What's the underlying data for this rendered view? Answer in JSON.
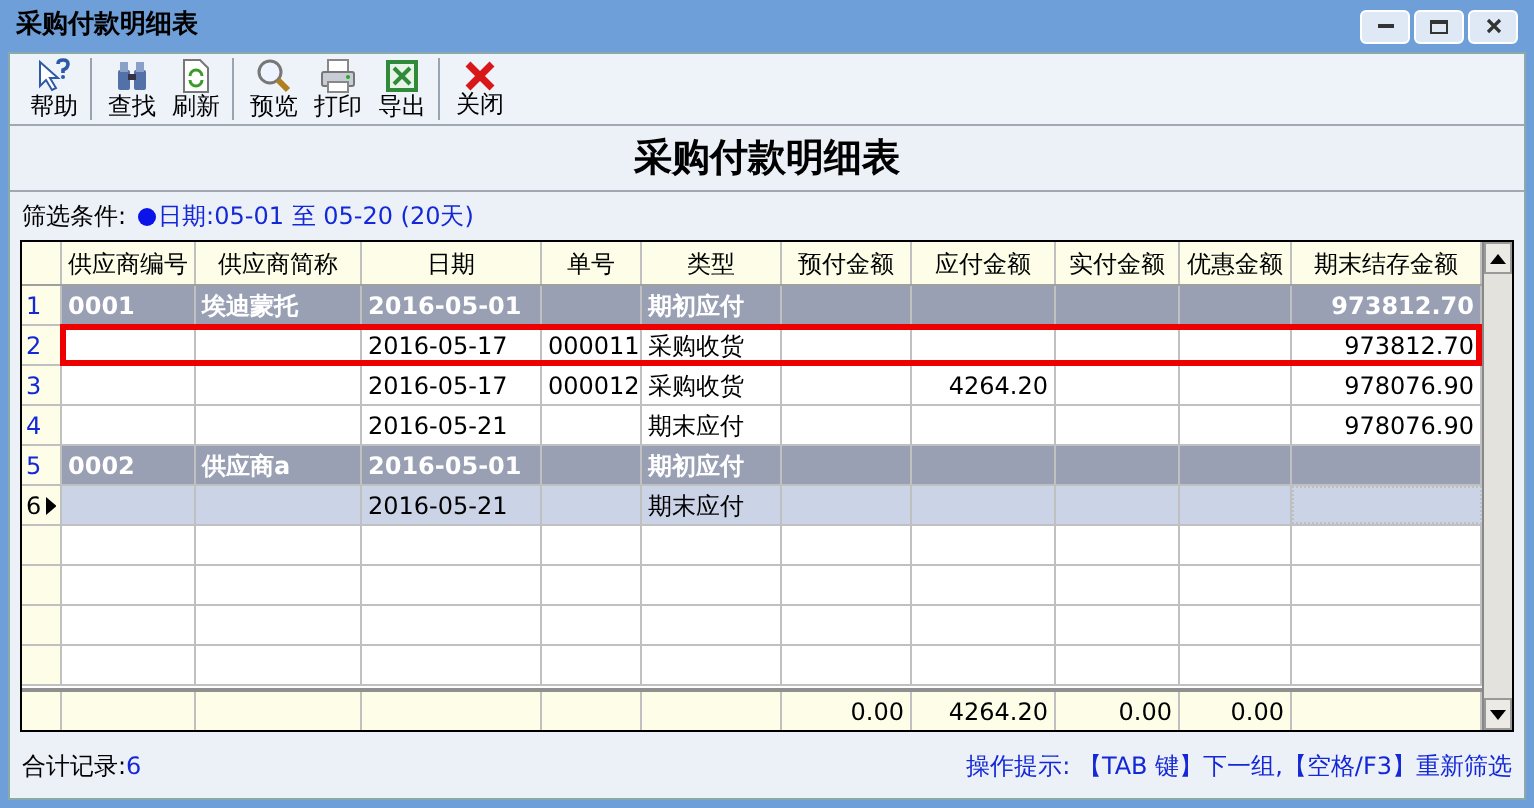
{
  "window": {
    "title": "采购付款明细表"
  },
  "toolbar": [
    {
      "kind": "help",
      "label": "帮助",
      "separator_after": true
    },
    {
      "kind": "find",
      "label": "查找",
      "separator_after": false
    },
    {
      "kind": "refresh",
      "label": "刷新",
      "separator_after": true
    },
    {
      "kind": "preview",
      "label": "预览",
      "separator_after": false
    },
    {
      "kind": "print",
      "label": "打印",
      "separator_after": false
    },
    {
      "kind": "export",
      "label": "导出",
      "separator_after": true
    },
    {
      "kind": "close",
      "label": "关闭",
      "separator_after": false
    }
  ],
  "report_title": "采购付款明细表",
  "filter": {
    "label": "筛选条件:",
    "value": "日期:05-01 至 05-20 (20天)"
  },
  "table": {
    "columns": [
      "供应商编号",
      "供应商简称",
      "日期",
      "单号",
      "类型",
      "预付金额",
      "应付金额",
      "实付金额",
      "优惠金额",
      "期末结存金额"
    ],
    "rows": [
      {
        "number": "1",
        "kind": "group",
        "highlighted": false,
        "current": false,
        "cells": [
          "0001",
          "埃迪蒙托",
          "2016-05-01",
          "",
          "期初应付",
          "",
          "",
          "",
          "",
          "973812.70"
        ]
      },
      {
        "number": "2",
        "kind": "detail",
        "highlighted": true,
        "current": false,
        "cells": [
          "",
          "",
          "2016-05-17",
          "000011",
          "采购收货",
          "",
          "",
          "",
          "",
          "973812.70"
        ]
      },
      {
        "number": "3",
        "kind": "detail",
        "highlighted": false,
        "current": false,
        "cells": [
          "",
          "",
          "2016-05-17",
          "000012",
          "采购收货",
          "",
          "4264.20",
          "",
          "",
          "978076.90"
        ]
      },
      {
        "number": "4",
        "kind": "detail",
        "highlighted": false,
        "current": false,
        "cells": [
          "",
          "",
          "2016-05-21",
          "",
          "期末应付",
          "",
          "",
          "",
          "",
          "978076.90"
        ]
      },
      {
        "number": "5",
        "kind": "group",
        "highlighted": false,
        "current": false,
        "cells": [
          "0002",
          "供应商a",
          "2016-05-01",
          "",
          "期初应付",
          "",
          "",
          "",
          "",
          ""
        ]
      },
      {
        "number": "6",
        "kind": "detail",
        "highlighted": false,
        "current": true,
        "cells": [
          "",
          "",
          "2016-05-21",
          "",
          "期末应付",
          "",
          "",
          "",
          "",
          ""
        ]
      }
    ],
    "totals": {
      "prepaid": "0.00",
      "payable": "4264.20",
      "paid": "0.00",
      "discount": "0.00"
    }
  },
  "status_bar": {
    "record_label": "合计记录:",
    "record_count": "6",
    "hint": "操作提示: 【TAB 键】下一组,【空格/F3】重新筛选"
  }
}
